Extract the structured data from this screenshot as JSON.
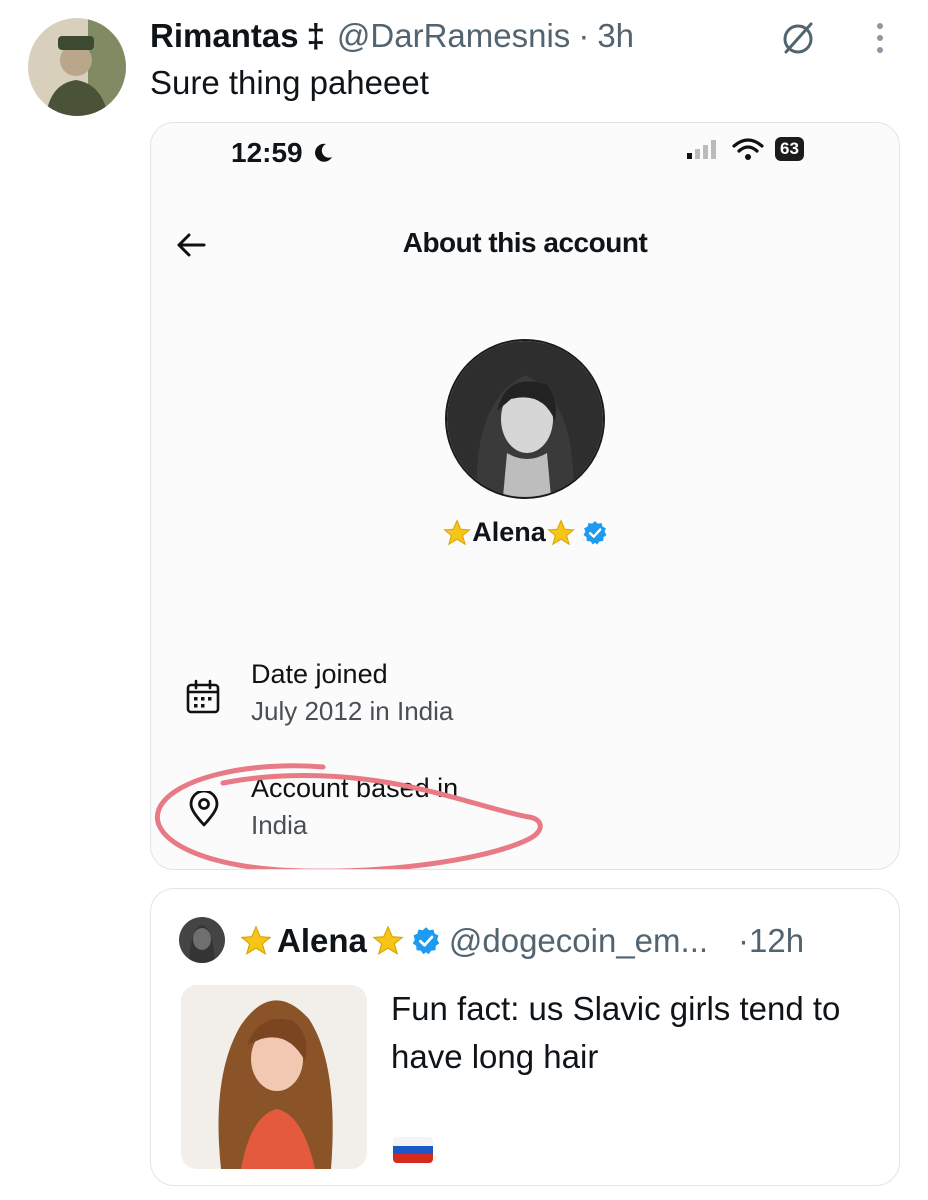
{
  "tweet": {
    "author_name": "Rimantas",
    "author_symbol": "‡",
    "handle": "@DarRamesnis",
    "separator": "·",
    "time": "3h",
    "text": "Sure thing paheeet",
    "icons": [
      "avatar",
      "slash-circle-icon",
      "more-vertical-icon"
    ]
  },
  "screenshot": {
    "status_bar": {
      "time": "12:59",
      "battery": "63",
      "icons": [
        "moon-icon",
        "signal-icon",
        "wifi-icon",
        "battery-icon"
      ]
    },
    "title": "About this account",
    "profile": {
      "name": "Alena",
      "decorations": [
        "star-icon",
        "star-icon",
        "verified-badge-icon"
      ]
    },
    "info": [
      {
        "label": "Date joined",
        "value": "July 2012 in India",
        "icon": "calendar-icon"
      },
      {
        "label": "Account based in",
        "value": "India",
        "icon": "location-pin-icon"
      }
    ],
    "annotation_color": "#e87a86"
  },
  "quote": {
    "name": "Alena",
    "handle": "@dogecoin_em...",
    "separator": "·",
    "time": "12h",
    "text": "Fun fact: us Slavic girls tend to have long hair",
    "flag": "russia-flag-icon"
  },
  "colors": {
    "text": "#0f1419",
    "muted": "#536471",
    "verified": "#1d9bf0",
    "star": "#f5c518"
  }
}
